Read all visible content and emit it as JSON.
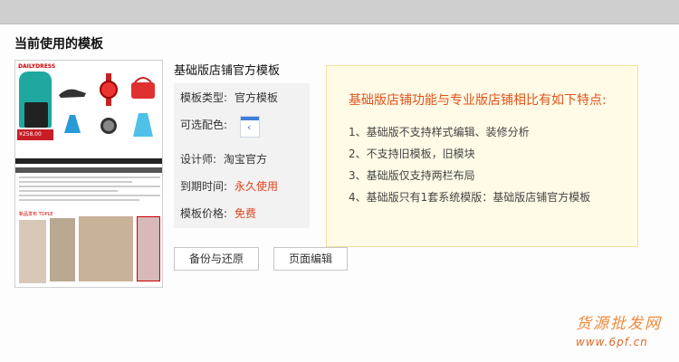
{
  "page": {
    "title": "当前使用的模板"
  },
  "template": {
    "name": "基础版店铺官方模板",
    "thumbnail": {
      "logo": "DAILYDRESS",
      "price": "¥258.00",
      "section": "新品发布 TOPLE"
    }
  },
  "info": {
    "type_label": "模板类型:",
    "type_value": "官方模板",
    "color_label": "可选配色:",
    "color_icon": "chevron-left-icon",
    "designer_label": "设计师:",
    "designer_value": "淘宝官方",
    "expire_label": "到期时间:",
    "expire_value": "永久使用",
    "price_label": "模板价格:",
    "price_value": "免费"
  },
  "buttons": {
    "backup": "备份与还原",
    "edit": "页面编辑"
  },
  "features": {
    "title": "基础版店铺功能与专业版店铺相比有如下特点:",
    "items": [
      "1、基础版不支持样式编辑、装修分析",
      "2、不支持旧模板，旧模块",
      "3、基础版仅支持两栏布局",
      "4、基础版只有1套系统模版：基础版店铺官方模板"
    ]
  },
  "watermark": {
    "line1": "货源批发网",
    "line2": "www.6pf.cn"
  },
  "colors": {
    "accent": "#e3421e",
    "feature_title": "#e0531d",
    "feature_bg": "#fffbe6"
  }
}
